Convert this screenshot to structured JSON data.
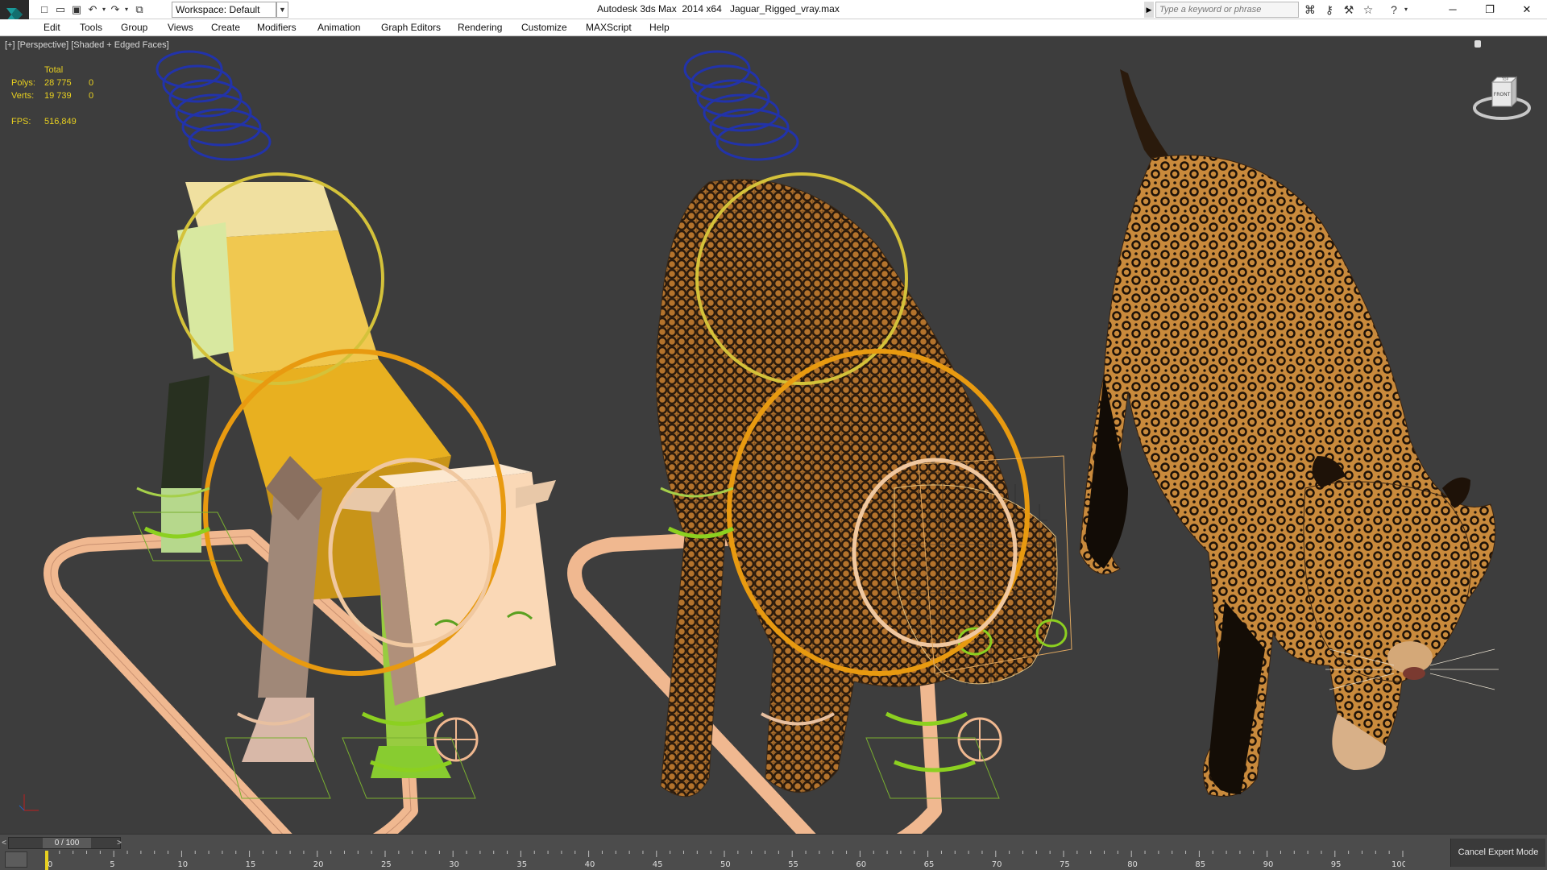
{
  "titlebar": {
    "workspace_label": "Workspace: Default",
    "app_title": "Autodesk 3ds Max  2014 x64",
    "file_name": "Jaguar_Rigged_vray.max",
    "search_placeholder": "Type a keyword or phrase"
  },
  "menu": {
    "items": [
      "Edit",
      "Tools",
      "Group",
      "Views",
      "Create",
      "Modifiers",
      "Animation",
      "Graph Editors",
      "Rendering",
      "Customize",
      "MAXScript",
      "Help"
    ]
  },
  "viewport": {
    "label": "[+] [Perspective] [Shaded + Edged Faces]",
    "stats": {
      "header": "Total",
      "polys_label": "Polys:",
      "polys_total": "28 775",
      "polys_selected": "0",
      "verts_label": "Verts:",
      "verts_total": "19 739",
      "verts_selected": "0",
      "fps_label": "FPS:",
      "fps_value": "516,849"
    },
    "viewcube_face": "FRONT",
    "viewcube_top": "TOP"
  },
  "timeline": {
    "frame_display": "0 / 100",
    "ticks": [
      "0",
      "5",
      "10",
      "15",
      "20",
      "25",
      "30",
      "35",
      "40",
      "45",
      "50",
      "55",
      "60",
      "65",
      "70",
      "75",
      "80",
      "85",
      "90",
      "95",
      "100"
    ],
    "cancel_expert_label": "Cancel Expert Mode"
  },
  "colors": {
    "viewport_bg": "#3d3d3d",
    "stats_text": "#e8d020",
    "spine_blue": "#2233aa",
    "ring_yellow": "#d4c23a",
    "ring_orange": "#e89a10",
    "ring_peach": "#f0c8a0",
    "body_yellow": "#e8b820",
    "ik_green": "#8cd020",
    "fur_orange": "#b8742a"
  }
}
